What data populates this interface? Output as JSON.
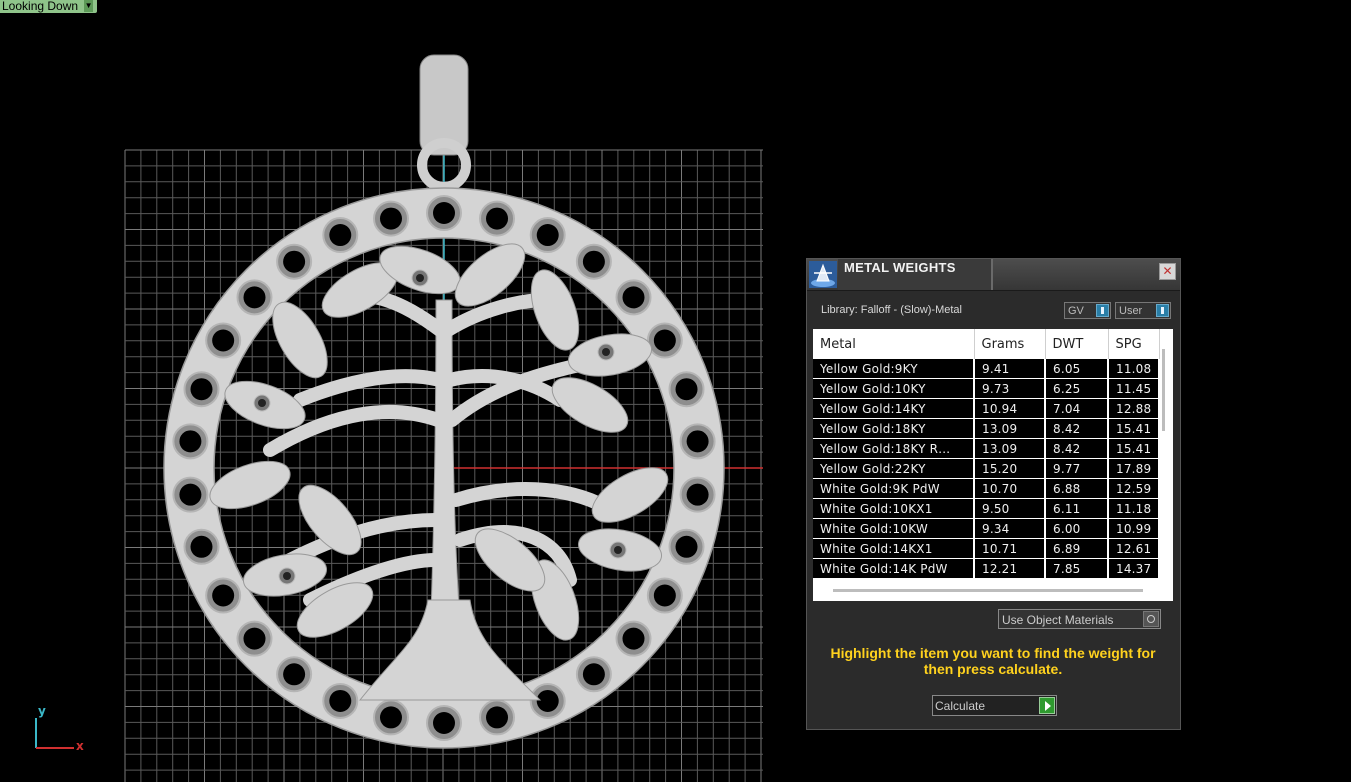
{
  "viewport": {
    "label": "Looking Down",
    "axis_y": "y",
    "axis_x": "x",
    "colors": {
      "background": "#000000",
      "grid": "#5a5a5a",
      "axis_x": "#d03030",
      "axis_y": "#3bb8c8",
      "model": "#d4d4d4"
    }
  },
  "panel": {
    "title": "METAL WEIGHTS",
    "close_icon": "close-icon",
    "library_label": "Library: Falloff - (Slow)-Metal",
    "toggle_gv": "GV",
    "toggle_user": "User",
    "columns": [
      "Metal",
      "Grams",
      "DWT",
      "SPG"
    ],
    "rows": [
      [
        "Yellow Gold:9KY",
        "9.41",
        "6.05",
        "11.08"
      ],
      [
        "Yellow Gold:10KY",
        "9.73",
        "6.25",
        "11.45"
      ],
      [
        "Yellow Gold:14KY",
        "10.94",
        "7.04",
        "12.88"
      ],
      [
        "Yellow Gold:18KY",
        "13.09",
        "8.42",
        "15.41"
      ],
      [
        "Yellow Gold:18KY R…",
        "13.09",
        "8.42",
        "15.41"
      ],
      [
        "Yellow Gold:22KY",
        "15.20",
        "9.77",
        "17.89"
      ],
      [
        "White Gold:9K PdW",
        "10.70",
        "6.88",
        "12.59"
      ],
      [
        "White Gold:10KX1",
        "9.50",
        "6.11",
        "11.18"
      ],
      [
        "White Gold:10KW",
        "9.34",
        "6.00",
        "10.99"
      ],
      [
        "White Gold:14KX1",
        "10.71",
        "6.89",
        "12.61"
      ],
      [
        "White Gold:14K PdW",
        "12.21",
        "7.85",
        "14.37"
      ]
    ],
    "use_object_materials": "Use Object Materials",
    "hint": "Highlight the item you want to find the weight for then press calculate.",
    "calculate_label": "Calculate"
  }
}
